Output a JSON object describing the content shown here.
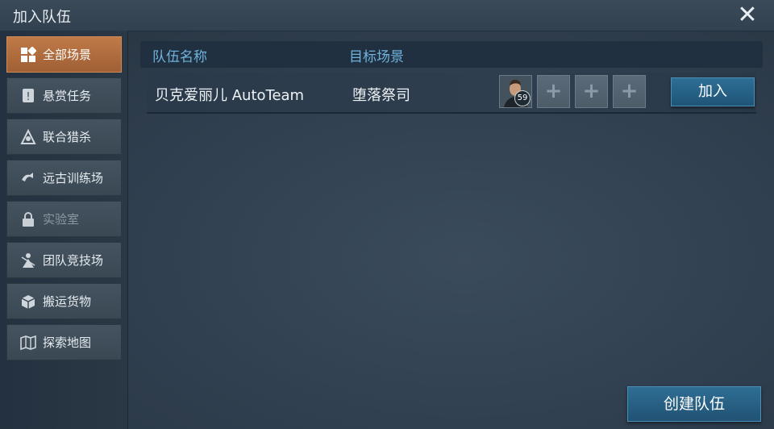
{
  "window": {
    "title": "加入队伍",
    "close_icon": "close-icon"
  },
  "sidebar": {
    "items": [
      {
        "label": "全部场景",
        "icon": "grid-icon",
        "active": true
      },
      {
        "label": "悬赏任务",
        "icon": "bounty-icon"
      },
      {
        "label": "联合猎杀",
        "icon": "hunt-icon"
      },
      {
        "label": "远古训练场",
        "icon": "training-icon"
      },
      {
        "label": "实验室",
        "icon": "lock-icon",
        "locked": true
      },
      {
        "label": "团队竞技场",
        "icon": "arena-icon"
      },
      {
        "label": "搬运货物",
        "icon": "cargo-icon"
      },
      {
        "label": "探索地图",
        "icon": "map-icon"
      }
    ]
  },
  "table": {
    "headers": {
      "team_name": "队伍名称",
      "target_scene": "目标场景"
    },
    "rows": [
      {
        "team_name": "贝克爱丽儿 AutoTeam",
        "target_scene": "堕落祭司",
        "member_level": "59",
        "empty_slot": "+",
        "join_label": "加入"
      }
    ]
  },
  "footer": {
    "create_label": "创建队伍"
  },
  "colors": {
    "accent": "#c07a48",
    "header_text": "#6fb3dd",
    "button": "#2e6e96"
  }
}
